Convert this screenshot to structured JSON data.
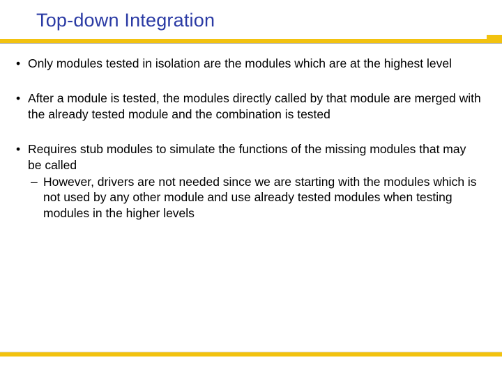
{
  "title": "Top-down Integration",
  "bullets": [
    {
      "text": "Only modules tested in isolation are the modules which are at the highest level"
    },
    {
      "text": "After a module is tested, the modules directly called by that module are merged with the already tested  module and the combination is tested"
    },
    {
      "text": "Requires stub modules to simulate the functions of the missing modules that may be called",
      "sub": [
        "However, drivers are not needed since we are starting with the modules which is not used by any other module and use already tested modules when testing modules in the higher levels"
      ]
    }
  ]
}
